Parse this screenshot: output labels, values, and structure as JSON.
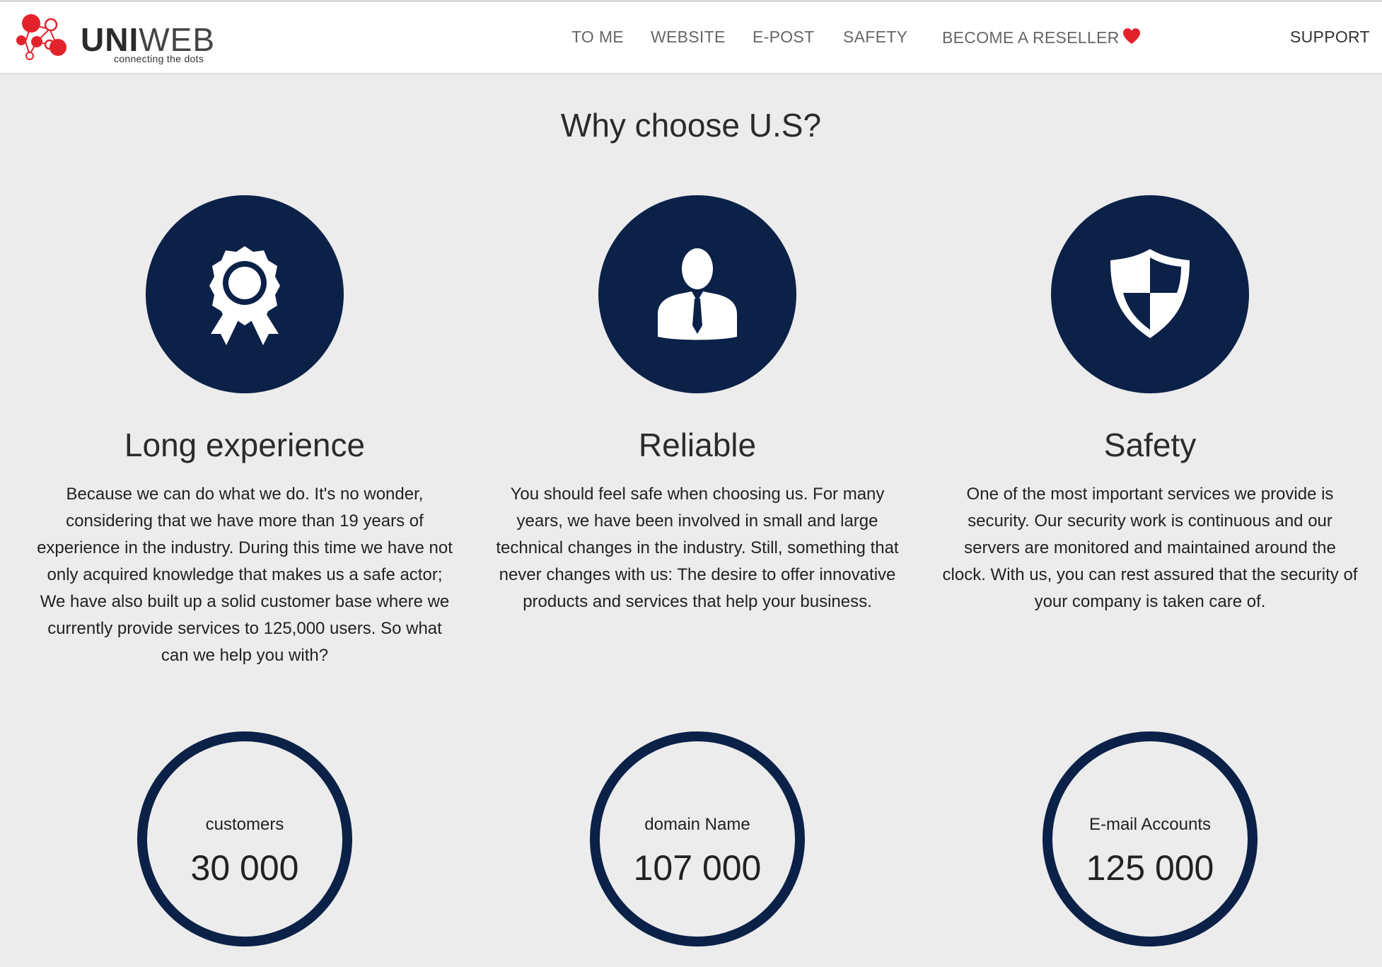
{
  "header": {
    "logo_primary": "UNI",
    "logo_secondary": "WEB",
    "logo_tagline": "connecting the dots",
    "nav": [
      {
        "label": "TO ME"
      },
      {
        "label": "WEBSITE"
      },
      {
        "label": "E-POST"
      },
      {
        "label": "SAFETY"
      },
      {
        "label": "BECOME A RESELLER"
      },
      {
        "label": "SUPPORT"
      }
    ]
  },
  "main": {
    "title": "Why choose U.S?",
    "features": [
      {
        "icon": "award-ribbon-icon",
        "title": "Long experience",
        "text": "Because we can do what we do. It's no wonder, considering that we have more than 19 years of experience in the industry. During this time we have not only acquired knowledge that makes us a safe actor; We have also built up a solid customer base where we currently provide services to 125,000 users. So what can we help you with?"
      },
      {
        "icon": "businessman-icon",
        "title": "Reliable",
        "text": "You should feel safe when choosing us. For many years, we have been involved in small and large technical changes in the industry. Still, something that never changes with us: The desire to offer innovative products and services that help your business."
      },
      {
        "icon": "shield-icon",
        "title": "Safety",
        "text": "One of the most important services we provide is security. Our security work is continuous and our servers are monitored and maintained around the clock. With us, you can rest assured that the security of your company is taken care of."
      }
    ],
    "stats": [
      {
        "label": "customers",
        "value": "30 000"
      },
      {
        "label": "domain Name",
        "value": "107 000"
      },
      {
        "label": "E-mail Accounts",
        "value": "125 000"
      }
    ]
  },
  "colors": {
    "brand_navy": "#0b2148",
    "logo_red": "#e3232c",
    "background": "#ececec"
  }
}
